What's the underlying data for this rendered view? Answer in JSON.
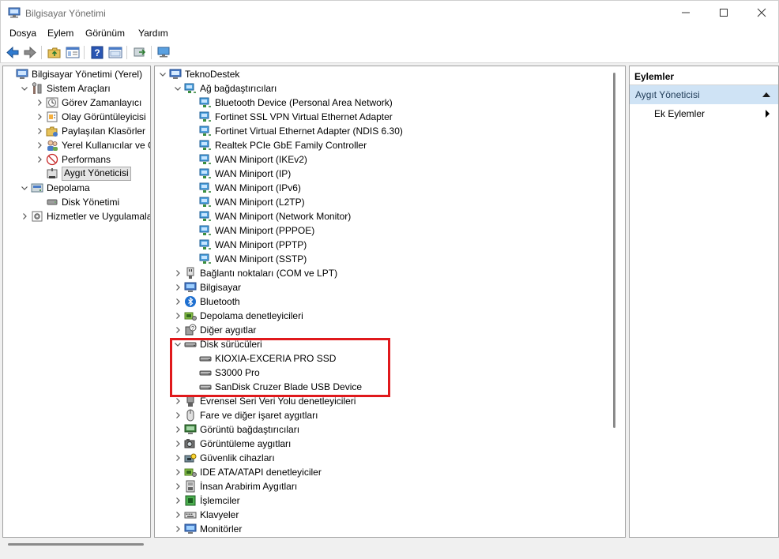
{
  "window": {
    "title": "Bilgisayar Yönetimi"
  },
  "menu": [
    "Dosya",
    "Eylem",
    "Görünüm",
    "Yardım"
  ],
  "left_tree": [
    {
      "label": "Bilgisayar Yönetimi (Yerel)",
      "level": 0,
      "expander": "none",
      "icon": "computer-management-icon"
    },
    {
      "label": "Sistem Araçları",
      "level": 1,
      "expander": "open",
      "icon": "tools-icon"
    },
    {
      "label": "Görev Zamanlayıcı",
      "level": 2,
      "expander": "closed",
      "icon": "clock-icon"
    },
    {
      "label": "Olay Görüntüleyicisi",
      "level": 2,
      "expander": "closed",
      "icon": "event-viewer-icon"
    },
    {
      "label": "Paylaşılan Klasörler",
      "level": 2,
      "expander": "closed",
      "icon": "shared-folder-icon"
    },
    {
      "label": "Yerel Kullanıcılar ve Gru",
      "level": 2,
      "expander": "closed",
      "icon": "users-icon"
    },
    {
      "label": "Performans",
      "level": 2,
      "expander": "closed",
      "icon": "performance-icon"
    },
    {
      "label": "Aygıt Yöneticisi",
      "level": 2,
      "expander": "none",
      "icon": "device-manager-icon",
      "selected": true
    },
    {
      "label": "Depolama",
      "level": 1,
      "expander": "open",
      "icon": "storage-icon"
    },
    {
      "label": "Disk Yönetimi",
      "level": 2,
      "expander": "none",
      "icon": "disk-icon"
    },
    {
      "label": "Hizmetler ve Uygulamalar",
      "level": 1,
      "expander": "closed",
      "icon": "services-icon"
    }
  ],
  "device_tree": [
    {
      "label": "TeknoDestek",
      "level": 0,
      "expander": "open",
      "icon": "computer-icon"
    },
    {
      "label": "Ağ bağdaştırıcıları",
      "level": 1,
      "expander": "open",
      "icon": "network-adapter-icon"
    },
    {
      "label": "Bluetooth Device (Personal Area Network)",
      "level": 2,
      "expander": "none",
      "icon": "network-adapter-icon"
    },
    {
      "label": "Fortinet SSL VPN Virtual Ethernet Adapter",
      "level": 2,
      "expander": "none",
      "icon": "network-adapter-icon"
    },
    {
      "label": "Fortinet Virtual Ethernet Adapter (NDIS 6.30)",
      "level": 2,
      "expander": "none",
      "icon": "network-adapter-icon"
    },
    {
      "label": "Realtek PCIe GbE Family Controller",
      "level": 2,
      "expander": "none",
      "icon": "network-adapter-icon"
    },
    {
      "label": "WAN Miniport (IKEv2)",
      "level": 2,
      "expander": "none",
      "icon": "network-adapter-icon"
    },
    {
      "label": "WAN Miniport (IP)",
      "level": 2,
      "expander": "none",
      "icon": "network-adapter-icon"
    },
    {
      "label": "WAN Miniport (IPv6)",
      "level": 2,
      "expander": "none",
      "icon": "network-adapter-icon"
    },
    {
      "label": "WAN Miniport (L2TP)",
      "level": 2,
      "expander": "none",
      "icon": "network-adapter-icon"
    },
    {
      "label": "WAN Miniport (Network Monitor)",
      "level": 2,
      "expander": "none",
      "icon": "network-adapter-icon"
    },
    {
      "label": "WAN Miniport (PPPOE)",
      "level": 2,
      "expander": "none",
      "icon": "network-adapter-icon"
    },
    {
      "label": "WAN Miniport (PPTP)",
      "level": 2,
      "expander": "none",
      "icon": "network-adapter-icon"
    },
    {
      "label": "WAN Miniport (SSTP)",
      "level": 2,
      "expander": "none",
      "icon": "network-adapter-icon"
    },
    {
      "label": "Bağlantı noktaları (COM ve LPT)",
      "level": 1,
      "expander": "closed",
      "icon": "port-icon"
    },
    {
      "label": "Bilgisayar",
      "level": 1,
      "expander": "closed",
      "icon": "monitor-icon"
    },
    {
      "label": "Bluetooth",
      "level": 1,
      "expander": "closed",
      "icon": "bluetooth-icon"
    },
    {
      "label": "Depolama denetleyicileri",
      "level": 1,
      "expander": "closed",
      "icon": "storage-controller-icon"
    },
    {
      "label": "Diğer aygıtlar",
      "level": 1,
      "expander": "closed",
      "icon": "unknown-device-icon"
    },
    {
      "label": "Disk sürücüleri",
      "level": 1,
      "expander": "open",
      "icon": "disk-drive-icon"
    },
    {
      "label": "KIOXIA-EXCERIA PRO SSD",
      "level": 2,
      "expander": "none",
      "icon": "disk-drive-icon"
    },
    {
      "label": "S3000 Pro",
      "level": 2,
      "expander": "none",
      "icon": "disk-drive-icon"
    },
    {
      "label": "SanDisk Cruzer Blade USB Device",
      "level": 2,
      "expander": "none",
      "icon": "disk-drive-icon"
    },
    {
      "label": "Evrensel Seri Veri Yolu denetleyicileri",
      "level": 1,
      "expander": "closed",
      "icon": "usb-icon"
    },
    {
      "label": "Fare ve diğer işaret aygıtları",
      "level": 1,
      "expander": "closed",
      "icon": "mouse-icon"
    },
    {
      "label": "Görüntü bağdaştırıcıları",
      "level": 1,
      "expander": "closed",
      "icon": "display-adapter-icon"
    },
    {
      "label": "Görüntüleme aygıtları",
      "level": 1,
      "expander": "closed",
      "icon": "camera-icon"
    },
    {
      "label": "Güvenlik cihazları",
      "level": 1,
      "expander": "closed",
      "icon": "security-device-icon"
    },
    {
      "label": "IDE ATA/ATAPI denetleyiciler",
      "level": 1,
      "expander": "closed",
      "icon": "ide-icon"
    },
    {
      "label": "İnsan Arabirim Aygıtları",
      "level": 1,
      "expander": "closed",
      "icon": "hid-icon"
    },
    {
      "label": "İşlemciler",
      "level": 1,
      "expander": "closed",
      "icon": "processor-icon"
    },
    {
      "label": "Klavyeler",
      "level": 1,
      "expander": "closed",
      "icon": "keyboard-icon"
    },
    {
      "label": "Monitörler",
      "level": 1,
      "expander": "closed",
      "icon": "monitor-icon"
    }
  ],
  "actions": {
    "title": "Eylemler",
    "section": "Aygıt Yöneticisi",
    "item": "Ek Eylemler"
  },
  "colors": {
    "highlight_box": "#e0191c",
    "actions_section_bg": "#cfe3f5"
  }
}
